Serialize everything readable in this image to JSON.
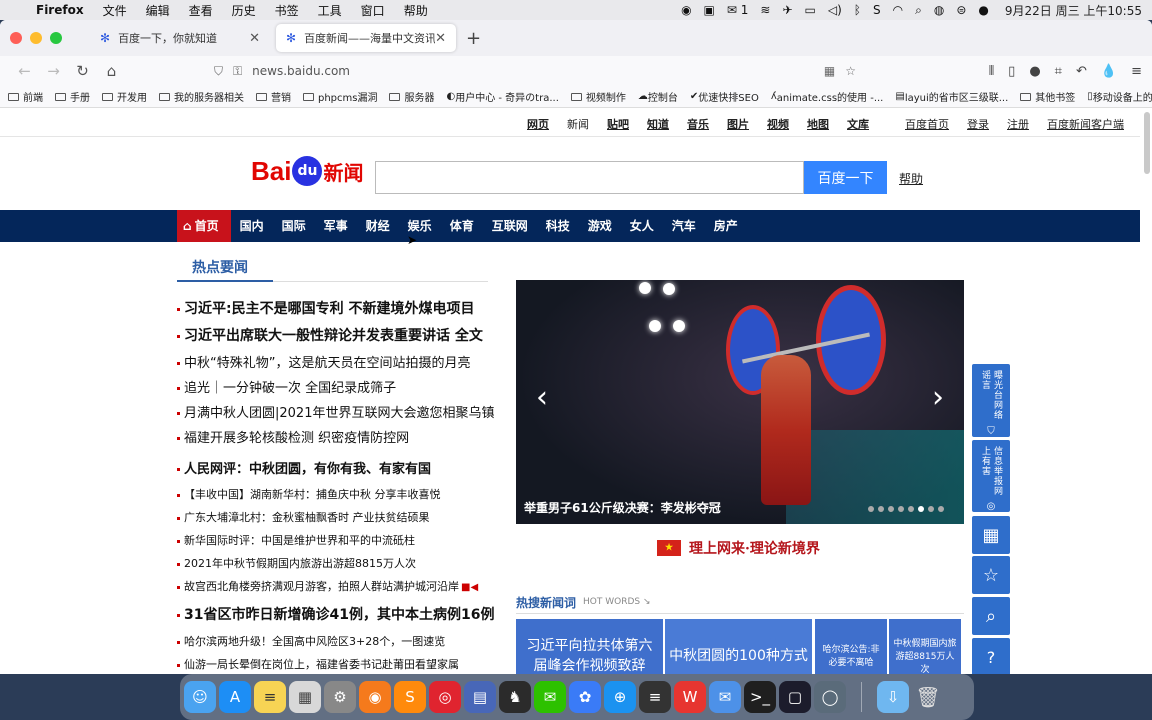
{
  "menubar": {
    "app": "Firefox",
    "items": [
      "文件",
      "编辑",
      "查看",
      "历史",
      "书签",
      "工具",
      "窗口",
      "帮助"
    ],
    "wechat_count": "1",
    "clock": "9月22日 周三 上午10:55"
  },
  "tabs": [
    {
      "title": "百度一下，你就知道",
      "active": false
    },
    {
      "title": "百度新闻——海量中文资讯平台",
      "active": true
    }
  ],
  "url": "news.baidu.com",
  "bookmarks": [
    "前端",
    "手册",
    "开发用",
    "我的服务器相关",
    "营销",
    "phpcms漏洞",
    "服务器",
    "用户中心 - 奇异のtra...",
    "视频制作",
    "控制台",
    "优速快排SEO",
    "animate.css的使用 -...",
    "layui的省市区三级联..."
  ],
  "bookmarks_right": [
    "其他书签",
    "移动设备上的书签"
  ],
  "toplinks": {
    "left": [
      "网页",
      "新闻",
      "贴吧",
      "知道",
      "音乐",
      "图片",
      "视频",
      "地图",
      "文库"
    ],
    "right": [
      "百度首页",
      "登录",
      "注册",
      "百度新闻客户端"
    ]
  },
  "logo": {
    "bai": "Bai",
    "du": "du",
    "news": "新闻"
  },
  "search": {
    "button": "百度一下",
    "help": "帮助"
  },
  "channels": [
    "首页",
    "国内",
    "国际",
    "军事",
    "财经",
    "娱乐",
    "体育",
    "互联网",
    "科技",
    "游戏",
    "女人",
    "汽车",
    "房产"
  ],
  "hot_section_title": "热点要闻",
  "news": [
    {
      "text": "习近平:民主不是哪国专利 不新建境外煤电项目",
      "style": "big",
      "dot": true
    },
    {
      "text": "习近平出席联大一般性辩论并发表重要讲话 全文",
      "style": "big",
      "dot": true
    },
    {
      "text": "中秋“特殊礼物”，这是航天员在空间站拍摄的月亮",
      "style": "mid",
      "dot": true
    },
    {
      "text": "追光｜一分钟破一次 全国纪录成筛子",
      "style": "mid",
      "dot": true
    },
    {
      "text": "月满中秋人团圆|2021年世界互联网大会邀您相聚乌镇",
      "style": "mid",
      "dot": true
    },
    {
      "text": "福建开展多轮核酸检测 织密疫情防控网",
      "style": "mid",
      "dot": true
    },
    {
      "text": "人民网评：中秋团圆，有你有我、有家有国",
      "style": "big",
      "dot": true
    },
    {
      "text": "【丰收中国】湖南新华村：捕鱼庆中秋 分享丰收喜悦",
      "style": "small",
      "dot": true
    },
    {
      "text": "广东大埔漳北村：金秋蜜柚飘香时 产业扶贫结硕果",
      "style": "small",
      "dot": true
    },
    {
      "text": "新华国际时评：中国是维护世界和平的中流砥柱",
      "style": "small",
      "dot": true
    },
    {
      "text": "2021年中秋节假期国内旅游出游超8815万人次",
      "style": "small",
      "dot": true
    },
    {
      "text": "故宫西北角楼旁挤满观月游客，拍照人群站满护城河沿岸",
      "style": "small",
      "dot": true
    },
    {
      "text": "31省区市昨日新增确诊41例，其中本土病例16例",
      "style": "big",
      "dot": true
    },
    {
      "text": "哈尔滨两地升级！全国高中风险区3+28个，一图速览",
      "style": "small",
      "dot": true
    },
    {
      "text": "仙游一局长晕倒在岗位上，福建省委书记赴莆田看望家属",
      "style": "small",
      "dot": true
    }
  ],
  "carousel": {
    "caption": "举重男子61公斤级决赛：李发彬夺冠",
    "dots": 8,
    "active_dot": 5
  },
  "banner": {
    "text": "理上网来·理论新境界",
    "flag_glyph": "★"
  },
  "hotwords": {
    "title": "热搜新闻词",
    "subtitle": "HOT WORDS",
    "items": [
      "习近平向拉共体第六届峰会作视频致辞",
      "中秋团圆的100种方式",
      "哈尔滨公告:非必要不离哈",
      "中秋假期国内旅游超8815万人次"
    ]
  },
  "float_bar": [
    "曝光台网络谣言",
    "信息举报网上有害"
  ],
  "dock_apps": [
    "Finder",
    "App Store",
    "Notes",
    "Launchpad",
    "System Preferences",
    "Firefox",
    "Sublime Text",
    "NetEase Music",
    "Archive",
    "TablePlus",
    "WeChat",
    "Lark",
    "Safari",
    "Chatting",
    "WPS",
    "Mail",
    "Terminal",
    "Monitor",
    "QuickTime",
    "Downloads",
    "Trash"
  ],
  "colors": {
    "brand_red": "#e10602",
    "nav_blue": "#04265a",
    "search_blue": "#3385ff",
    "hot_blue": "#2d5ea5"
  }
}
